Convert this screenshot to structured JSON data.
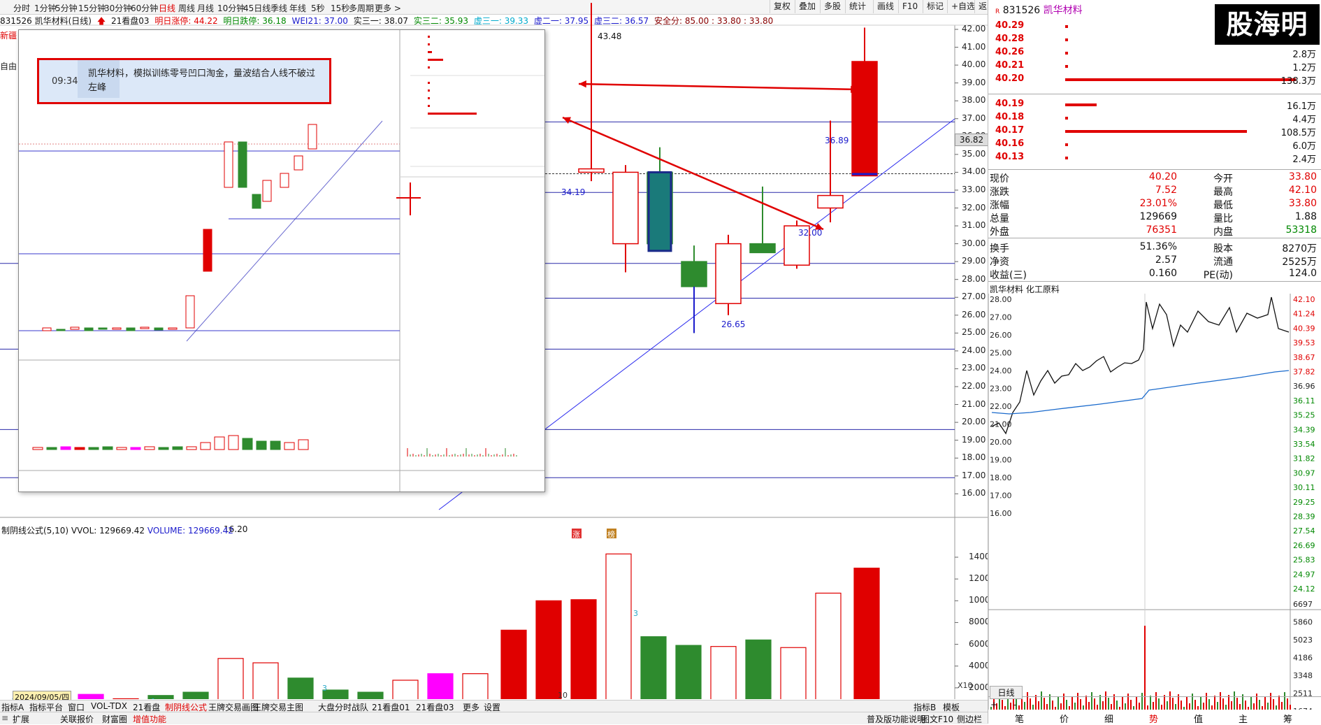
{
  "toolbar": {
    "tabs": [
      "分时",
      "1分钟",
      "5分钟",
      "15分钟",
      "30分钟",
      "60分钟",
      "日线",
      "周线",
      "月线",
      "10分钟",
      "45日线",
      "季线",
      "年线",
      "5秒",
      "15秒",
      "多周期",
      "更多 >"
    ],
    "active_tab": "日线",
    "right_tools": [
      "复权",
      "叠加",
      "多股",
      "统计",
      "画线",
      "F10",
      "标记",
      "+自选",
      "返回"
    ]
  },
  "info": {
    "code_name": "831526 凯华材料(日线)",
    "indicator": "21看盘03",
    "tomorrow_up": "明日涨停: 44.22",
    "tomorrow_down": "明日跌停: 36.18",
    "wei21": "WEI21: 37.00",
    "shi3_1": "实三一: 38.07",
    "shi3_2": "实三二: 35.93",
    "xu3_1": "虚三一: 39.33",
    "xu2_1": "虚二一: 37.95",
    "xu3_2": "虚三二: 36.57",
    "safe": "安全分: 85.00 : 33.80 : 33.80"
  },
  "left_labels": {
    "a": "新疆",
    "b": "自由"
  },
  "price_axis": [
    "42.00",
    "41.00",
    "40.00",
    "39.00",
    "38.00",
    "37.00",
    "36.00",
    "35.00",
    "34.00",
    "33.00",
    "32.00",
    "31.00",
    "30.00",
    "29.00",
    "28.00",
    "27.00",
    "26.00",
    "25.00",
    "24.00",
    "23.00",
    "22.00",
    "21.00",
    "20.00",
    "19.00",
    "18.00",
    "17.00",
    "16.00"
  ],
  "current_price_tag": "36.82",
  "annotations": {
    "high": "43.48",
    "p1": "34.19",
    "p2": "36.89",
    "p3": "32.00",
    "p4": "26.65",
    "low": "16.20"
  },
  "markers": {
    "zhang": "涨",
    "bang": "榜"
  },
  "vol_header": {
    "title": "制阴线公式(5,10)",
    "vvol": "VVOL: 129669.42",
    "volume": "VOLUME: 129669.42"
  },
  "vol_axis": [
    "14000",
    "12000",
    "10000",
    "8000",
    "6000",
    "4000",
    "2000"
  ],
  "vol_unit": "X10",
  "vol_marks": [
    "1",
    "1",
    "1",
    "3",
    "3"
  ],
  "chart_data": {
    "type": "candlestick",
    "candles": [
      {
        "o": 34.19,
        "c": 34.0,
        "h": 43.48,
        "l": 33.5,
        "color": "red"
      },
      {
        "o": 34.0,
        "c": 30.0,
        "h": 34.4,
        "l": 28.4,
        "color": "red"
      },
      {
        "o": 34.0,
        "c": 30.0,
        "h": 35.4,
        "l": 29.6,
        "color": "green"
      },
      {
        "o": 29.0,
        "c": 27.6,
        "h": 29.9,
        "l": 25.0,
        "color": "green"
      },
      {
        "o": 26.65,
        "c": 30.0,
        "h": 30.5,
        "l": 26.0,
        "color": "red"
      },
      {
        "o": 30.0,
        "c": 29.5,
        "h": 33.2,
        "l": 29.5,
        "color": "green"
      },
      {
        "o": 28.8,
        "c": 31.0,
        "h": 31.3,
        "l": 28.6,
        "color": "red"
      },
      {
        "o": 32.0,
        "c": 32.7,
        "h": 36.89,
        "l": 31.2,
        "color": "red"
      },
      {
        "o": 33.8,
        "c": 40.2,
        "h": 42.1,
        "l": 33.8,
        "color": "red"
      }
    ],
    "volume": [
      {
        "v": 14300,
        "color": "red"
      },
      {
        "v": 7300,
        "color": "green"
      },
      {
        "v": 6000,
        "color": "green"
      },
      {
        "v": 5900,
        "color": "red"
      },
      {
        "v": 6400,
        "color": "green"
      },
      {
        "v": 5700,
        "color": "red"
      },
      {
        "v": 10800,
        "color": "red"
      },
      {
        "v": 13000,
        "color": "redfill"
      }
    ],
    "ylim": [
      15.5,
      43.5
    ]
  },
  "date_label": "2024/09/05/四",
  "date_mark": "10",
  "bottom_tabs": [
    "指标A",
    "指标平台",
    "窗口",
    "VOL-TDX",
    "21看盘",
    "制阴线公式",
    "王牌交易画图",
    "王牌交易主图",
    "大盘分时战队",
    "21看盘01",
    "21看盘03",
    "更多",
    "设置"
  ],
  "bottom_right_tabs": [
    "指标B",
    "模板"
  ],
  "bottom_tabs2": [
    "扩展",
    "关联报价",
    "财富圈",
    "增值功能"
  ],
  "bottom_status": [
    "普及版功能说明",
    "图文F10",
    "侧边栏"
  ],
  "right_panel": {
    "code": "831526",
    "name": "凯华材料",
    "logo": "股海明灯",
    "sell": [
      {
        "p": "40.29",
        "v": "",
        "bar": 4
      },
      {
        "p": "40.28",
        "v": "",
        "bar": 4
      },
      {
        "p": "40.26",
        "v": "2.8万",
        "bar": 4
      },
      {
        "p": "40.21",
        "v": "1.2万",
        "bar": 4
      },
      {
        "p": "40.20",
        "v": "138.3万",
        "bar": 330
      }
    ],
    "buy": [
      {
        "p": "40.19",
        "v": "16.1万",
        "bar": 45
      },
      {
        "p": "40.18",
        "v": "4.4万",
        "bar": 4
      },
      {
        "p": "40.17",
        "v": "108.5万",
        "bar": 260
      },
      {
        "p": "40.16",
        "v": "6.0万",
        "bar": 4
      },
      {
        "p": "40.13",
        "v": "2.4万",
        "bar": 4
      }
    ],
    "stats": [
      [
        "现价",
        "40.20",
        "今开",
        "33.80"
      ],
      [
        "涨跌",
        "7.52",
        "最高",
        "42.10"
      ],
      [
        "涨幅",
        "23.01%",
        "最低",
        "33.80"
      ],
      [
        "总量",
        "129669",
        "量比",
        "1.88"
      ],
      [
        "外盘",
        "76351",
        "内盘",
        "53318"
      ],
      [
        "换手",
        "51.36%",
        "股本",
        "8270万"
      ],
      [
        "净资",
        "2.57",
        "流通",
        "2525万"
      ],
      [
        "收益(三)",
        "0.160",
        "PE(动)",
        "124.0"
      ]
    ],
    "mini_title": "凯华材料  化工原料",
    "mini_axis_left": [
      "28.00",
      "27.00",
      "26.00",
      "25.00",
      "24.00",
      "23.00",
      "22.00",
      "21.00",
      "20.00",
      "19.00",
      "18.00",
      "17.00",
      "16.00"
    ],
    "mini_axis_right": [
      "42.10",
      "41.24",
      "40.39",
      "39.53",
      "38.67",
      "37.82",
      "36.96",
      "36.11",
      "35.25",
      "34.39",
      "33.54",
      "31.82",
      "30.97",
      "30.11",
      "29.25",
      "28.39",
      "27.54",
      "26.69",
      "25.83",
      "24.97",
      "24.12"
    ],
    "mini_vol_axis": [
      "6697",
      "5860",
      "5023",
      "4186",
      "3348",
      "2511",
      "1674",
      "837"
    ],
    "date_btn": "日线",
    "plus": "+",
    "minus": "-",
    "bottom": [
      "笔",
      "价",
      "细",
      "势",
      "值",
      "主",
      "筹"
    ]
  },
  "callout": {
    "time": "09:34",
    "text": "凯华材料，模拟训练零号凹口淘金，量波结合人线不破过左峰"
  }
}
